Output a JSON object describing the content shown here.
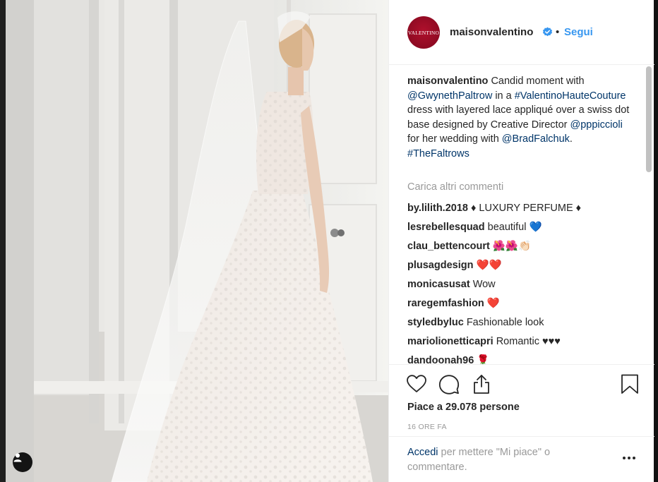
{
  "post": {
    "avatar_text": "VALENTINO",
    "username": "maisonvalentino",
    "separator": "•",
    "follow_label": "Segui",
    "caption": {
      "username": "maisonvalentino",
      "part1": " Candid moment with ",
      "mention1": "@GwynethPaltrow",
      "part2": " in a ",
      "hashtag1": "#ValentinoHauteCouture",
      "part3": " dress with layered lace appliqué over a swiss dot base designed by Creative Director ",
      "mention2": "@pppiccioli",
      "part4": " for her wedding with ",
      "mention3": "@BradFalchuk",
      "part5": ". ",
      "hashtag2": "#TheFaltrows"
    },
    "load_more_label": "Carica altri commenti",
    "comments": [
      {
        "user": "by.lilith.2018",
        "text": "♦ LUXURY PERFUME ♦"
      },
      {
        "user": "lesrebellesquad",
        "text": "beautiful 💙"
      },
      {
        "user": "clau_bettencourt",
        "text": "🌺🌺👏🏻"
      },
      {
        "user": "plusagdesign",
        "text": "❤️❤️"
      },
      {
        "user": "monicasusat",
        "text": "Wow"
      },
      {
        "user": "raregemfashion",
        "text": "❤️"
      },
      {
        "user": "styledbyluc",
        "text": "Fashionable look"
      },
      {
        "user": "mariolionetticapri",
        "text": "Romantic ♥♥♥"
      },
      {
        "user": "dandoonah96",
        "text": "🌹"
      }
    ],
    "likes_text": "Piace a 29.078 persone",
    "time_ago": "16 ORE FA",
    "login_link": "Accedi",
    "login_rest": " per mettere \"Mi piace\" o commentare."
  },
  "colors": {
    "accent": "#3897f0",
    "link": "#003569",
    "brand": "#a00d28"
  },
  "icons": {
    "like": "heart-outline",
    "comment": "speech-bubble",
    "share": "upload",
    "save": "bookmark",
    "options": "three-dots",
    "user_tag": "person"
  }
}
